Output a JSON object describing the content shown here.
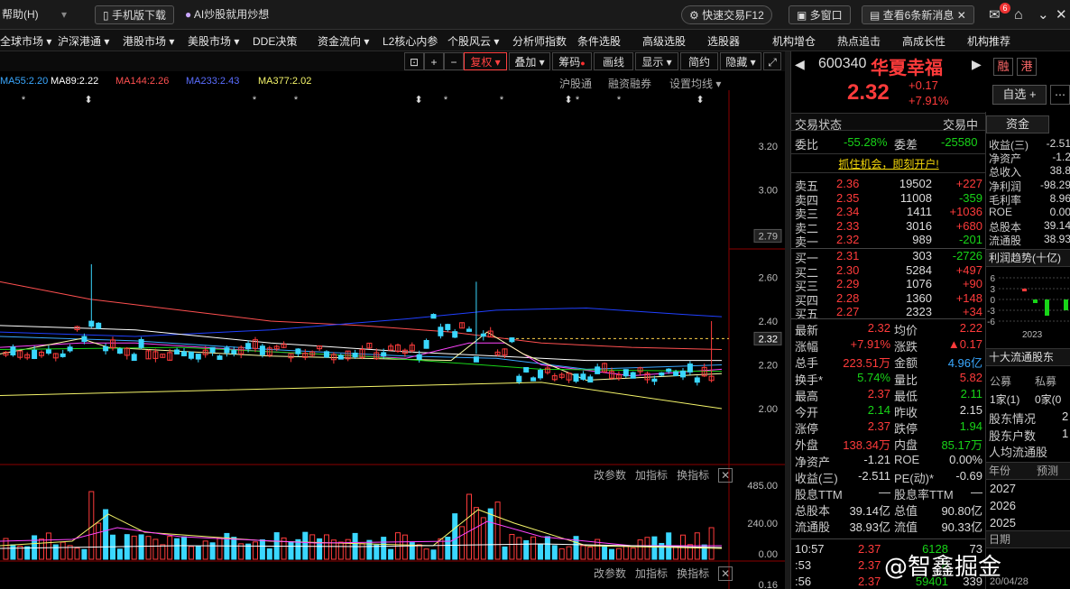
{
  "topbar": {
    "help": "帮助(H)",
    "mobile_download": "手机版下载",
    "ai_promo": "AI炒股就用炒想",
    "quick_trade": "快速交易F12",
    "multi_window": "多窗口",
    "news": "查看6条新消息",
    "news_badge": "6"
  },
  "nav": [
    "全球市场 ▾",
    "沪深港通 ▾",
    "港股市场 ▾",
    "美股市场 ▾",
    "DDE决策",
    "资金流向 ▾",
    "L2核心内参",
    "个股风云 ▾",
    "分析师指数",
    "条件选股",
    "高级选股",
    "选股器",
    "机构增仓",
    "热点追击",
    "高成长性",
    "机构推荐"
  ],
  "toolbar": {
    "fuquan": "复权 ▾",
    "overlay": "叠加 ▾",
    "chip": "筹码",
    "draw": "画线",
    "show": "显示 ▾",
    "simple": "简约",
    "hide": "隐藏 ▾"
  },
  "ma": [
    {
      "label": "MA55:2.20",
      "color": "#3aa8ff"
    },
    {
      "label": "MA89:2.22",
      "color": "#ffffff"
    },
    {
      "label": "MA144:2.26",
      "color": "#ff5050"
    },
    {
      "label": "MA233:2.43",
      "color": "#5a6dff"
    },
    {
      "label": "MA377:2.02",
      "color": "#f5f56a"
    }
  ],
  "chart_links": {
    "hgt": "沪股通",
    "rzrq": "融资融券",
    "set_ma": "设置均线 ▾"
  },
  "yaxis": [
    "3.20",
    "3.00",
    "2.79",
    "2.60",
    "2.40",
    "2.32",
    "2.20",
    "2.00"
  ],
  "vol_axis": [
    "485.00",
    "240.00",
    "0.00",
    "0.16"
  ],
  "indicator_links": {
    "params": "改参数",
    "add": "加指标",
    "change": "换指标"
  },
  "stock": {
    "code": "600340",
    "name": "华夏幸福",
    "price": "2.32",
    "change": "+0.17",
    "pct": "+7.91%",
    "tags": [
      "融",
      "港"
    ],
    "watch_btn": "自选 +",
    "status_label": "交易状态",
    "status_value": "交易中",
    "wb_label": "委比",
    "wb_value": "-55.28%",
    "wc_label": "委差",
    "wc_value": "-25580",
    "open_account": "抓住机会，即刻开户!"
  },
  "asks": [
    {
      "label": "卖五",
      "price": "2.36",
      "vol": "19502",
      "chg": "+227"
    },
    {
      "label": "卖四",
      "price": "2.35",
      "vol": "11008",
      "chg": "-359"
    },
    {
      "label": "卖三",
      "price": "2.34",
      "vol": "1411",
      "chg": "+1036"
    },
    {
      "label": "卖二",
      "price": "2.33",
      "vol": "3016",
      "chg": "+680"
    },
    {
      "label": "卖一",
      "price": "2.32",
      "vol": "989",
      "chg": "-201"
    }
  ],
  "bids": [
    {
      "label": "买一",
      "price": "2.31",
      "vol": "303",
      "chg": "-2726"
    },
    {
      "label": "买二",
      "price": "2.30",
      "vol": "5284",
      "chg": "+497"
    },
    {
      "label": "买三",
      "price": "2.29",
      "vol": "1076",
      "chg": "+90"
    },
    {
      "label": "买四",
      "price": "2.28",
      "vol": "1360",
      "chg": "+148"
    },
    {
      "label": "买五",
      "price": "2.27",
      "vol": "2323",
      "chg": "+34"
    }
  ],
  "stats": [
    {
      "l1": "最新",
      "v1": "2.32",
      "l2": "均价",
      "v2": "2.22"
    },
    {
      "l1": "涨幅",
      "v1": "+7.91%",
      "l2": "涨跌",
      "v2": "▲0.17"
    },
    {
      "l1": "总手",
      "v1": "223.51万",
      "l2": "金额",
      "v2": "4.96亿"
    },
    {
      "l1": "换手*",
      "v1": "5.74%",
      "l2": "量比",
      "v2": "5.82"
    },
    {
      "l1": "最高",
      "v1": "2.37",
      "l2": "最低",
      "v2": "2.11"
    },
    {
      "l1": "今开",
      "v1": "2.14",
      "l2": "昨收",
      "v2": "2.15"
    },
    {
      "l1": "涨停",
      "v1": "2.37",
      "l2": "跌停",
      "v2": "1.94"
    },
    {
      "l1": "外盘",
      "v1": "138.34万",
      "l2": "内盘",
      "v2": "85.17万"
    },
    {
      "l1": "净资产",
      "v1": "-1.21",
      "l2": "ROE",
      "v2": "0.00%"
    },
    {
      "l1": "收益(三)",
      "v1": "-2.511",
      "l2": "PE(动)*",
      "v2": "-0.69"
    },
    {
      "l1": "股息TTM",
      "v1": "—",
      "l2": "股息率TTM",
      "v2": "—"
    },
    {
      "l1": "总股本",
      "v1": "39.14亿",
      "l2": "总值",
      "v2": "90.80亿"
    },
    {
      "l1": "流通股",
      "v1": "38.93亿",
      "l2": "流值",
      "v2": "90.33亿"
    }
  ],
  "ticks": [
    {
      "time": "10:57",
      "price": "2.37",
      "vol": "6128",
      "n": "73"
    },
    {
      "time": ":53",
      "price": "2.37",
      "vol": "8",
      "n": ""
    },
    {
      "time": ":56",
      "price": "2.37",
      "vol": "59401",
      "n": "339"
    }
  ],
  "funds": {
    "tab": "资金",
    "rows": [
      {
        "l": "收益(三)",
        "v": "-2.51"
      },
      {
        "l": "净资产",
        "v": "-1.2"
      },
      {
        "l": "总收入",
        "v": "38.8"
      },
      {
        "l": "净利润",
        "v": "-98.29"
      },
      {
        "l": "毛利率",
        "v": "8.96"
      },
      {
        "l": "ROE",
        "v": "0.00"
      },
      {
        "l": "总股本",
        "v": "39.14"
      },
      {
        "l": "流通股",
        "v": "38.93"
      }
    ],
    "profit_title": "利润趋势(十亿)",
    "profit_axis": [
      "6",
      "3",
      "0",
      "-3",
      "-6"
    ],
    "profit_year": "2023",
    "holders_title": "十大流通股东",
    "holders_cols": [
      "公募",
      "私募"
    ],
    "holders_row": [
      "1家(1)",
      "0家(0"
    ],
    "holder_items": [
      {
        "l": "股东情况",
        "v": "2"
      },
      {
        "l": "股东户数",
        "v": "1"
      },
      {
        "l": "人均流通股",
        "v": ""
      }
    ],
    "year_header": [
      "年份",
      "预测"
    ],
    "years": [
      "2027",
      "2026",
      "2025"
    ],
    "date_label": "日期",
    "date_value": "20/04/28"
  },
  "watermark": "@智鑫掘金",
  "chart_data": {
    "type": "candlestick",
    "ylim": [
      1.95,
      3.25
    ],
    "last_price": 2.32,
    "ma_lines": [
      {
        "name": "MA55",
        "color": "#3aa8ff"
      },
      {
        "name": "MA89",
        "color": "#ffffff"
      },
      {
        "name": "MA144",
        "color": "#ff5050"
      },
      {
        "name": "MA233",
        "color": "#5a6dff"
      },
      {
        "name": "MA377",
        "color": "#f5f56a"
      }
    ]
  }
}
